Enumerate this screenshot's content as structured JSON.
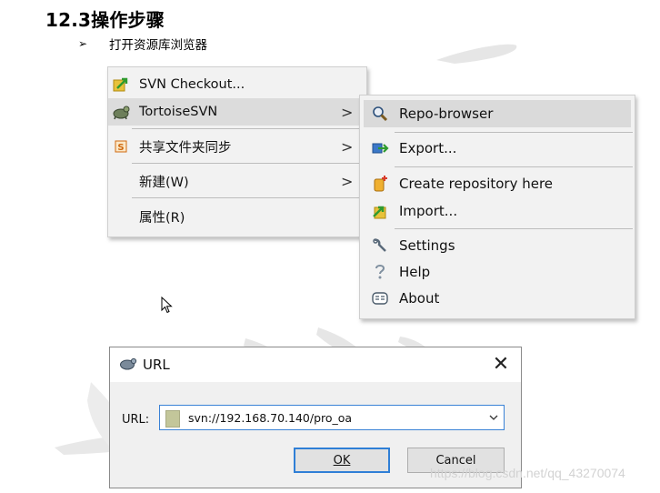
{
  "heading": "12.3操作步骤",
  "bullet": {
    "symbol": "➢",
    "text": "打开资源库浏览器"
  },
  "context_menu": {
    "items": [
      {
        "label": "SVN Checkout...",
        "icon": "svn-checkout-icon",
        "has_submenu": false,
        "highlighted": false
      },
      {
        "label": "TortoiseSVN",
        "icon": "tortoisesvn-icon",
        "has_submenu": true,
        "highlighted": true
      },
      {
        "label": "共享文件夹同步",
        "icon": "share-sync-icon",
        "has_submenu": true,
        "highlighted": false
      },
      {
        "label": "新建(W)",
        "icon": "",
        "has_submenu": true,
        "highlighted": false
      },
      {
        "label": "属性(R)",
        "icon": "",
        "has_submenu": false,
        "highlighted": false
      }
    ],
    "chevron": ">"
  },
  "submenu": {
    "items": [
      {
        "label": "Repo-browser",
        "icon": "repo-browser-icon",
        "highlighted": true
      },
      {
        "label": "Export...",
        "icon": "export-icon",
        "highlighted": false
      },
      {
        "label": "Create repository here",
        "icon": "create-repository-icon",
        "highlighted": false
      },
      {
        "label": "Import...",
        "icon": "import-icon",
        "highlighted": false
      },
      {
        "label": "Settings",
        "icon": "settings-icon",
        "highlighted": false
      },
      {
        "label": "Help",
        "icon": "help-icon",
        "highlighted": false
      },
      {
        "label": "About",
        "icon": "about-icon",
        "highlighted": false
      }
    ]
  },
  "dialog": {
    "title": "URL",
    "close_symbol": "✕",
    "url_label": "URL:",
    "url_value": "svn://192.168.70.140/pro_oa",
    "ok_label": "OK",
    "cancel_label": "Cancel"
  },
  "footer_url": "https://blog.csdn.net/qq_43270074",
  "colors": {
    "menu_bg": "#f2f2f2",
    "menu_highlight": "#dcdcdc",
    "dialog_bg": "#f0f0f0",
    "focus_blue": "#2f7fd6"
  }
}
